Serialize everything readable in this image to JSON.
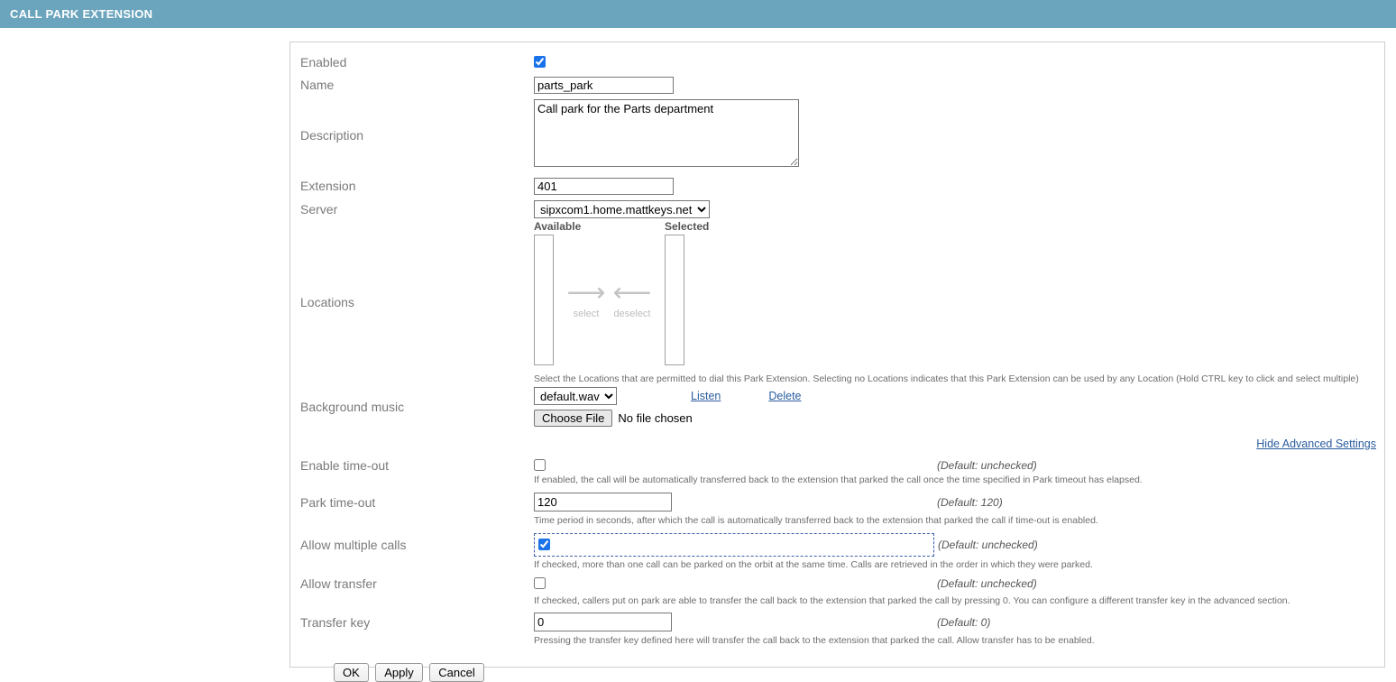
{
  "header": {
    "title": "CALL PARK EXTENSION"
  },
  "form": {
    "enabled": {
      "label": "Enabled",
      "checked": true
    },
    "name": {
      "label": "Name",
      "value": "parts_park"
    },
    "description": {
      "label": "Description",
      "value": "Call park for the Parts department"
    },
    "extension": {
      "label": "Extension",
      "value": "401"
    },
    "server": {
      "label": "Server",
      "value": "sipxcom1.home.mattkeys.net"
    },
    "locations": {
      "label": "Locations",
      "available_label": "Available",
      "selected_label": "Selected",
      "select_button": "select",
      "deselect_button": "deselect",
      "available_items": [],
      "selected_items": [],
      "hint": "Select the Locations that are permitted to dial this Park Extension. Selecting no Locations indicates that this Park Extension can be used by any Location (Hold CTRL key to click and select multiple)"
    },
    "background_music": {
      "label": "Background music",
      "value": "default.wav",
      "listen_link": "Listen",
      "delete_link": "Delete",
      "choose_file_button": "Choose File",
      "file_status": "No file chosen"
    },
    "advanced_toggle": "Hide Advanced Settings",
    "enable_timeout": {
      "label": "Enable time-out",
      "checked": false,
      "default_note": "(Default: unchecked)",
      "hint": "If enabled, the call will be automatically transferred back to the extension that parked the call once the time specified in Park timeout has elapsed."
    },
    "park_timeout": {
      "label": "Park time-out",
      "value": "120",
      "default_note": "(Default: 120)",
      "hint": "Time period in seconds, after which the call is automatically transferred back to the extension that parked the call if time-out is enabled."
    },
    "allow_multiple_calls": {
      "label": "Allow multiple calls",
      "checked": true,
      "default_note": "(Default: unchecked)",
      "hint": "If checked, more than one call can be parked on the orbit at the same time. Calls are retrieved in the order in which they were parked."
    },
    "allow_transfer": {
      "label": "Allow transfer",
      "checked": false,
      "default_note": "(Default: unchecked)",
      "hint": "If checked, callers put on park are able to transfer the call back to the extension that parked the call by pressing 0. You can configure a different transfer key in the advanced section."
    },
    "transfer_key": {
      "label": "Transfer key",
      "value": "0",
      "default_note": "(Default: 0)",
      "hint": "Pressing the transfer key defined here will transfer the call back to the extension that parked the call. Allow transfer has to be enabled."
    },
    "buttons": {
      "ok": "OK",
      "apply": "Apply",
      "cancel": "Cancel"
    }
  }
}
